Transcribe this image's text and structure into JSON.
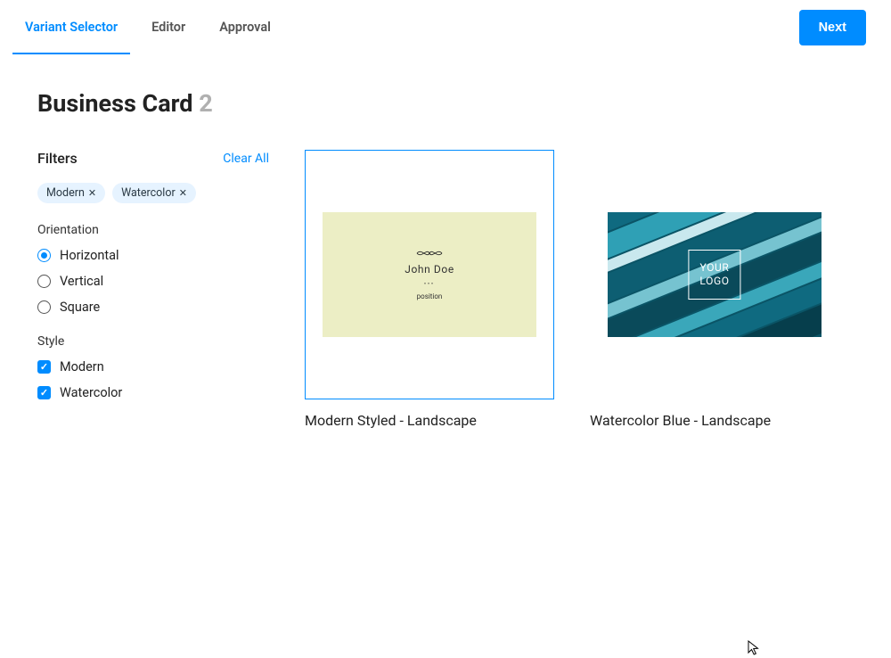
{
  "tabs": [
    {
      "label": "Variant Selector",
      "active": true
    },
    {
      "label": "Editor",
      "active": false
    },
    {
      "label": "Approval",
      "active": false
    }
  ],
  "next_label": "Next",
  "page": {
    "title": "Business Card",
    "count": "2"
  },
  "filters": {
    "label": "Filters",
    "clear_all": "Clear All",
    "chips": [
      {
        "label": "Modern"
      },
      {
        "label": "Watercolor"
      }
    ],
    "groups": [
      {
        "title": "Orientation",
        "type": "radio",
        "options": [
          {
            "label": "Horizontal",
            "checked": true
          },
          {
            "label": "Vertical",
            "checked": false
          },
          {
            "label": "Square",
            "checked": false
          }
        ]
      },
      {
        "title": "Style",
        "type": "checkbox",
        "options": [
          {
            "label": "Modern",
            "checked": true
          },
          {
            "label": "Watercolor",
            "checked": true
          }
        ]
      }
    ]
  },
  "cards": [
    {
      "title": "Modern Styled - Landscape",
      "selected": true,
      "preview": {
        "name": "John Doe",
        "position": "position"
      }
    },
    {
      "title": "Watercolor Blue - Landscape",
      "selected": false,
      "preview": {
        "logo_line1": "YOUR",
        "logo_line2": "LOGO"
      }
    }
  ]
}
